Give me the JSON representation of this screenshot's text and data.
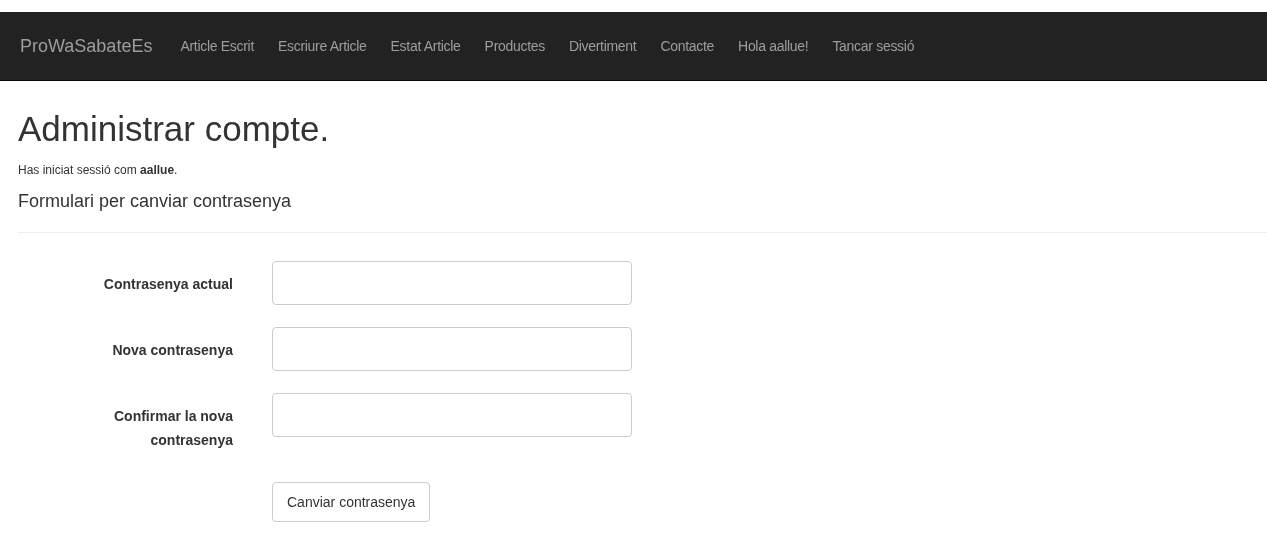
{
  "navbar": {
    "brand": "ProWaSabateEs",
    "links": [
      "Article Escrit",
      "Escriure Article",
      "Estat Article",
      "Productes",
      "Divertiment",
      "Contacte",
      "Hola aallue!",
      "Tancar sessió"
    ]
  },
  "heading": "Administrar compte.",
  "login_note": "Has iniciat sessió com **aallue**.",
  "form": {
    "title": "Formulari per canviar contrasenya",
    "fields": [
      {
        "label": "Contrasenya actual"
      },
      {
        "label": "Nova contrasenya"
      },
      {
        "label": "Confirmar la nova contrasenya"
      }
    ],
    "submit": "Canviar contrasenya"
  }
}
